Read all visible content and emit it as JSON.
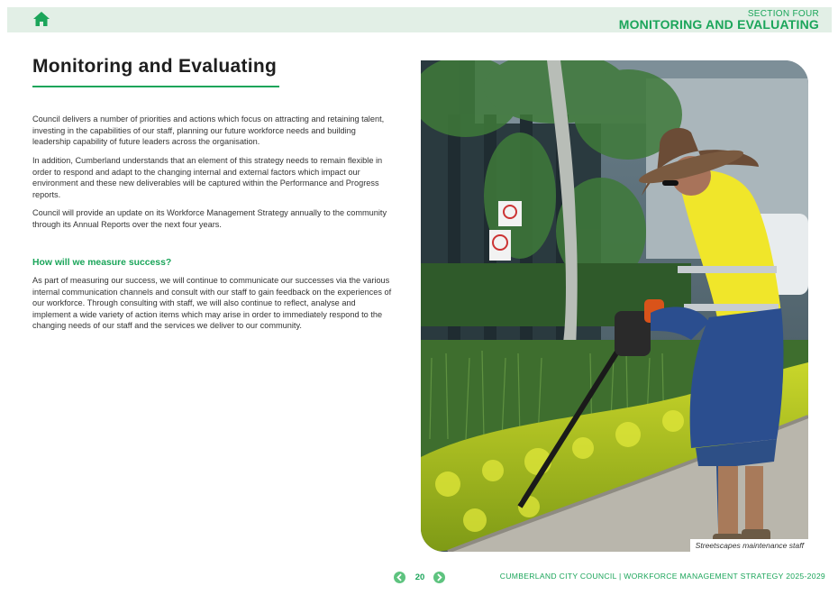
{
  "header": {
    "section_label": "SECTION FOUR",
    "section_title": "MONITORING AND EVALUATING",
    "home_icon": "home-icon"
  },
  "main": {
    "title": "Monitoring and Evaluating",
    "paragraphs": [
      "Council delivers a number of priorities and actions which focus on attracting and retaining talent, investing in the capabilities of our staff, planning our future workforce needs and building leadership capability of future leaders across the organisation.",
      "In addition, Cumberland understands that an element of this strategy needs to remain flexible in order to respond and adapt to the changing internal and external factors which impact our environment and these new deliverables will be captured within the Performance and Progress reports.",
      "Council will provide an update on its Workforce Management Strategy annually to the community through its Annual Reports over the next four years."
    ],
    "subheading": "How will we measure success?",
    "success_paragraph": "As part of measuring our success, we will continue to communicate our successes via the various internal communication channels and consult with our staff to gain feedback on the experiences of our workforce. Through consulting with staff, we will also continue to reflect, analyse and implement a wide variety of action items which may arise in order to immediately respond to the changing needs of our staff and the services we deliver to our community."
  },
  "photo": {
    "caption": "Streetscapes maintenance staff"
  },
  "footer": {
    "page_number": "20",
    "prev_icon": "chevron-left-icon",
    "next_icon": "chevron-right-icon",
    "text": "CUMBERLAND CITY COUNCIL  |  WORKFORCE MANAGEMENT STRATEGY 2025-2029"
  },
  "colors": {
    "accent": "#1ba55a",
    "header_bg": "#e2efe6"
  }
}
